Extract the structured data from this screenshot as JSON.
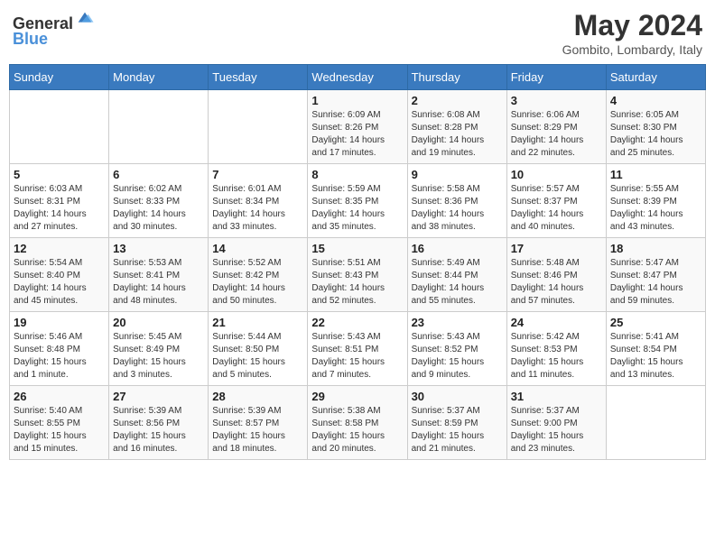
{
  "header": {
    "logo_line1": "General",
    "logo_line2": "Blue",
    "month_title": "May 2024",
    "location": "Gombito, Lombardy, Italy"
  },
  "weekdays": [
    "Sunday",
    "Monday",
    "Tuesday",
    "Wednesday",
    "Thursday",
    "Friday",
    "Saturday"
  ],
  "weeks": [
    [
      {
        "day": "",
        "info": ""
      },
      {
        "day": "",
        "info": ""
      },
      {
        "day": "",
        "info": ""
      },
      {
        "day": "1",
        "info": "Sunrise: 6:09 AM\nSunset: 8:26 PM\nDaylight: 14 hours\nand 17 minutes."
      },
      {
        "day": "2",
        "info": "Sunrise: 6:08 AM\nSunset: 8:28 PM\nDaylight: 14 hours\nand 19 minutes."
      },
      {
        "day": "3",
        "info": "Sunrise: 6:06 AM\nSunset: 8:29 PM\nDaylight: 14 hours\nand 22 minutes."
      },
      {
        "day": "4",
        "info": "Sunrise: 6:05 AM\nSunset: 8:30 PM\nDaylight: 14 hours\nand 25 minutes."
      }
    ],
    [
      {
        "day": "5",
        "info": "Sunrise: 6:03 AM\nSunset: 8:31 PM\nDaylight: 14 hours\nand 27 minutes."
      },
      {
        "day": "6",
        "info": "Sunrise: 6:02 AM\nSunset: 8:33 PM\nDaylight: 14 hours\nand 30 minutes."
      },
      {
        "day": "7",
        "info": "Sunrise: 6:01 AM\nSunset: 8:34 PM\nDaylight: 14 hours\nand 33 minutes."
      },
      {
        "day": "8",
        "info": "Sunrise: 5:59 AM\nSunset: 8:35 PM\nDaylight: 14 hours\nand 35 minutes."
      },
      {
        "day": "9",
        "info": "Sunrise: 5:58 AM\nSunset: 8:36 PM\nDaylight: 14 hours\nand 38 minutes."
      },
      {
        "day": "10",
        "info": "Sunrise: 5:57 AM\nSunset: 8:37 PM\nDaylight: 14 hours\nand 40 minutes."
      },
      {
        "day": "11",
        "info": "Sunrise: 5:55 AM\nSunset: 8:39 PM\nDaylight: 14 hours\nand 43 minutes."
      }
    ],
    [
      {
        "day": "12",
        "info": "Sunrise: 5:54 AM\nSunset: 8:40 PM\nDaylight: 14 hours\nand 45 minutes."
      },
      {
        "day": "13",
        "info": "Sunrise: 5:53 AM\nSunset: 8:41 PM\nDaylight: 14 hours\nand 48 minutes."
      },
      {
        "day": "14",
        "info": "Sunrise: 5:52 AM\nSunset: 8:42 PM\nDaylight: 14 hours\nand 50 minutes."
      },
      {
        "day": "15",
        "info": "Sunrise: 5:51 AM\nSunset: 8:43 PM\nDaylight: 14 hours\nand 52 minutes."
      },
      {
        "day": "16",
        "info": "Sunrise: 5:49 AM\nSunset: 8:44 PM\nDaylight: 14 hours\nand 55 minutes."
      },
      {
        "day": "17",
        "info": "Sunrise: 5:48 AM\nSunset: 8:46 PM\nDaylight: 14 hours\nand 57 minutes."
      },
      {
        "day": "18",
        "info": "Sunrise: 5:47 AM\nSunset: 8:47 PM\nDaylight: 14 hours\nand 59 minutes."
      }
    ],
    [
      {
        "day": "19",
        "info": "Sunrise: 5:46 AM\nSunset: 8:48 PM\nDaylight: 15 hours\nand 1 minute."
      },
      {
        "day": "20",
        "info": "Sunrise: 5:45 AM\nSunset: 8:49 PM\nDaylight: 15 hours\nand 3 minutes."
      },
      {
        "day": "21",
        "info": "Sunrise: 5:44 AM\nSunset: 8:50 PM\nDaylight: 15 hours\nand 5 minutes."
      },
      {
        "day": "22",
        "info": "Sunrise: 5:43 AM\nSunset: 8:51 PM\nDaylight: 15 hours\nand 7 minutes."
      },
      {
        "day": "23",
        "info": "Sunrise: 5:43 AM\nSunset: 8:52 PM\nDaylight: 15 hours\nand 9 minutes."
      },
      {
        "day": "24",
        "info": "Sunrise: 5:42 AM\nSunset: 8:53 PM\nDaylight: 15 hours\nand 11 minutes."
      },
      {
        "day": "25",
        "info": "Sunrise: 5:41 AM\nSunset: 8:54 PM\nDaylight: 15 hours\nand 13 minutes."
      }
    ],
    [
      {
        "day": "26",
        "info": "Sunrise: 5:40 AM\nSunset: 8:55 PM\nDaylight: 15 hours\nand 15 minutes."
      },
      {
        "day": "27",
        "info": "Sunrise: 5:39 AM\nSunset: 8:56 PM\nDaylight: 15 hours\nand 16 minutes."
      },
      {
        "day": "28",
        "info": "Sunrise: 5:39 AM\nSunset: 8:57 PM\nDaylight: 15 hours\nand 18 minutes."
      },
      {
        "day": "29",
        "info": "Sunrise: 5:38 AM\nSunset: 8:58 PM\nDaylight: 15 hours\nand 20 minutes."
      },
      {
        "day": "30",
        "info": "Sunrise: 5:37 AM\nSunset: 8:59 PM\nDaylight: 15 hours\nand 21 minutes."
      },
      {
        "day": "31",
        "info": "Sunrise: 5:37 AM\nSunset: 9:00 PM\nDaylight: 15 hours\nand 23 minutes."
      },
      {
        "day": "",
        "info": ""
      }
    ]
  ]
}
